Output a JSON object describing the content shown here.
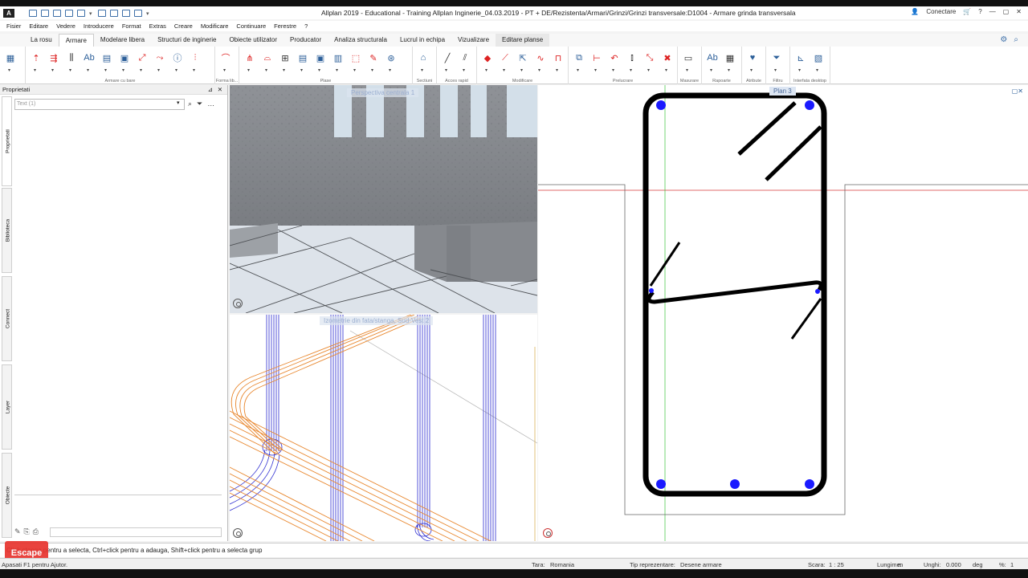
{
  "window": {
    "title": "Allplan 2019 - Educational - Training Allplan Inginerie_04.03.2019 - PT + DE/Rezistenta/Armari/Grinzi/Grinzi transversale:D1004 - Armare grinda transversala",
    "connect_label": "Conectare"
  },
  "menu": [
    "Fisier",
    "Editare",
    "Vedere",
    "Introducere",
    "Format",
    "Extras",
    "Creare",
    "Modificare",
    "Continuare",
    "Ferestre",
    "?"
  ],
  "ribbon_tabs": [
    {
      "label": "La rosu"
    },
    {
      "label": "Armare"
    },
    {
      "label": "Modelare libera"
    },
    {
      "label": "Structuri de inginerie"
    },
    {
      "label": "Obiecte utilizator"
    },
    {
      "label": "Producator"
    },
    {
      "label": "Analiza structurala"
    },
    {
      "label": "Lucrul in echipa"
    },
    {
      "label": "Vizualizare"
    },
    {
      "label": "Editare planse"
    }
  ],
  "ribbon_groups": [
    {
      "label": "Armare cu bare"
    },
    {
      "label": "Forma lib..."
    },
    {
      "label": "Plase"
    },
    {
      "label": "Sectiuni"
    },
    {
      "label": "Acces rapid"
    },
    {
      "label": "Modificare"
    },
    {
      "label": "Prelucrare"
    },
    {
      "label": "Masurare"
    },
    {
      "label": "Rapoarte"
    },
    {
      "label": "Atribute"
    },
    {
      "label": "Filtru"
    },
    {
      "label": "Interfata desktop"
    }
  ],
  "left_panel": {
    "title": "Proprietati",
    "search_placeholder": "Text (1)",
    "vertical_tabs": [
      "Proprietati",
      "Biblioteca",
      "Connect",
      "Layer",
      "Obiecte"
    ]
  },
  "viewports": {
    "perspective_label": "Perspectiva centrala 1",
    "isometric_label": "Izometrie din fata/stanga, Sud-Vest 2",
    "plan_label": "Plan 3"
  },
  "command_line": "Click stanga pentru a selecta, Ctrl+click pentru a adauga, Shift+click pentru a selecta grup",
  "escape_label": "Escape",
  "status": {
    "help": "Apasati F1 pentru Ajutor.",
    "country_label": "Tara:",
    "country": "Romania",
    "repr_label": "Tip reprezentare:",
    "repr": "Desene armare",
    "scale_label": "Scara:",
    "scale": "1 : 25",
    "length_label": "Lungime:",
    "length_unit": "m",
    "angle_label": "Unghi:",
    "angle": "0.000",
    "angle_unit": "deg",
    "percent_label": "%:",
    "percent": "1"
  },
  "colors": {
    "rebar_highlight": "#1a1aff",
    "bar_orange": "#e8872e",
    "bar_blue": "#2b2bd0",
    "cursor_green": "#39c23a",
    "cursor_red": "#d83a3a"
  }
}
